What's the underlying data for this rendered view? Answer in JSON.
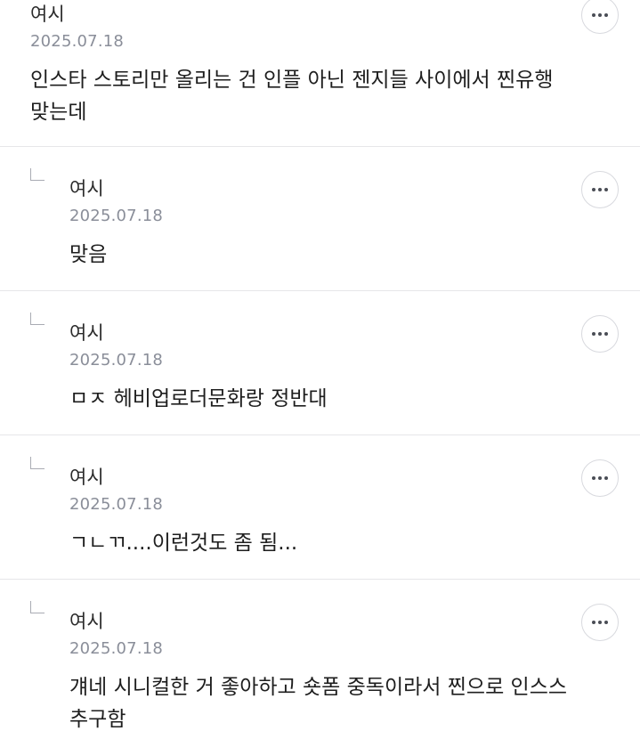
{
  "comments": [
    {
      "author": "여시",
      "date": "2025.07.18",
      "text": "인스타 스토리만 올리는 건 인플 아닌 젠지들 사이에서 찐유행 맞는데",
      "more_icon": "more-horizontal-icon"
    },
    {
      "author": "여시",
      "date": "2025.07.18",
      "text": "맞음",
      "reply_icon": "reply-arrow-icon",
      "more_icon": "more-horizontal-icon"
    },
    {
      "author": "여시",
      "date": "2025.07.18",
      "text": "ㅁㅈ 헤비업로더문화랑 정반대",
      "reply_icon": "reply-arrow-icon",
      "more_icon": "more-horizontal-icon"
    },
    {
      "author": "여시",
      "date": "2025.07.18",
      "text": "ㄱㄴㄲ....이런것도 좀 됨...",
      "reply_icon": "reply-arrow-icon",
      "more_icon": "more-horizontal-icon"
    },
    {
      "author": "여시",
      "date": "2025.07.18",
      "text": "걔네 시니컬한 거 좋아하고 숏폼 중독이라서 찐으로 인스스 추구함",
      "reply_icon": "reply-arrow-icon",
      "more_icon": "more-horizontal-icon"
    }
  ],
  "colors": {
    "text": "#1e1e1e",
    "date": "#8a8e99",
    "divider": "#e6e6e9",
    "button_border": "#d8d9de"
  }
}
